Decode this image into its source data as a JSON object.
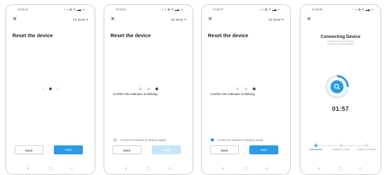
{
  "screens": [
    {
      "status_time": "17:02:14",
      "status_icons": "▪ ◐ ▤ ≋ ▂▄ ▭",
      "ez_mode": "EZ Mode",
      "title": "Reset the device",
      "step_left": "1",
      "step_right": "3",
      "back": "Back",
      "next": "Next"
    },
    {
      "status_time": "17:02:21",
      "status_icons": "▪ ◐ ▤ ≋ ▂▄ ▭",
      "ez_mode": "EZ Mode",
      "title": "Reset the device",
      "confirm": "Confirm the indicator is blinking",
      "check_label": "Confirm the indicator is blinking rapidly",
      "back": "Back",
      "next": "Next"
    },
    {
      "status_time": "17:02:27",
      "status_icons": "▪ ◐ ▤ ≋ ▂▄ ▭",
      "ez_mode": "EZ Mode",
      "title": "Reset the device",
      "confirm": "Confirm the indicator is blinking",
      "check_label": "Confirm the indicator is blinking rapidly",
      "back": "Back",
      "next": "Next"
    },
    {
      "status_time": "17:02:36",
      "status_icons": "▪ ◐ ▤ ≋ ▂▄ ▭",
      "title": "Connecting Device",
      "subtitle_1": "Please keep the device",
      "subtitle_2": "Keep the network stable",
      "timer": "01:57",
      "steps": [
        "Scan devices",
        "Register on Cloud",
        "Initialize the device"
      ]
    }
  ],
  "nav_icons": {
    "menu": "≡",
    "home": "▢",
    "back": "◁"
  },
  "colors": {
    "accent": "#2b9ae8",
    "accent_light": "#c6e5f9",
    "text": "#1d1d1d"
  }
}
